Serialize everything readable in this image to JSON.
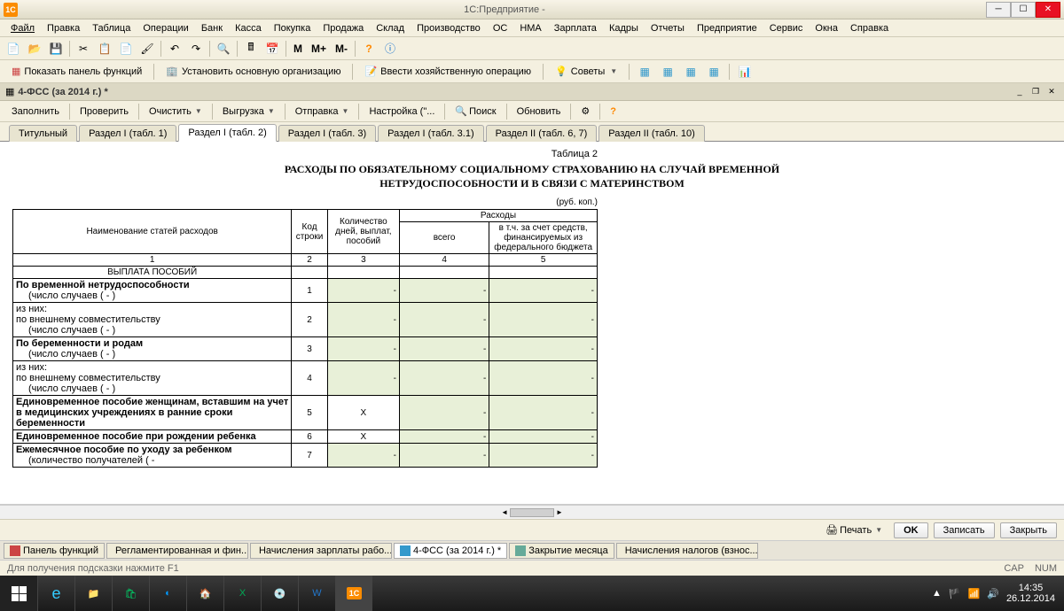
{
  "titlebar": {
    "app": "1С:Предприятие -"
  },
  "menu": [
    "Файл",
    "Правка",
    "Таблица",
    "Операции",
    "Банк",
    "Касса",
    "Покупка",
    "Продажа",
    "Склад",
    "Производство",
    "ОС",
    "НМА",
    "Зарплата",
    "Кадры",
    "Отчеты",
    "Предприятие",
    "Сервис",
    "Окна",
    "Справка"
  ],
  "toolbar2": {
    "show_panel": "Показать панель функций",
    "set_org": "Установить основную организацию",
    "enter_op": "Ввести хозяйственную операцию",
    "tips": "Советы"
  },
  "doc": {
    "title": "4-ФСС (за 2014 г.) *"
  },
  "doc_toolbar": {
    "fill": "Заполнить",
    "check": "Проверить",
    "clear": "Очистить",
    "export": "Выгрузка",
    "send": "Отправка",
    "setup": "Настройка (\"...",
    "search": "Поиск",
    "refresh": "Обновить"
  },
  "tabs": [
    "Титульный",
    "Раздел I (табл. 1)",
    "Раздел I (табл. 2)",
    "Раздел I (табл. 3)",
    "Раздел I (табл. 3.1)",
    "Раздел II (табл. 6, 7)",
    "Раздел II (табл. 10)"
  ],
  "active_tab": 2,
  "report": {
    "table_num": "Таблица 2",
    "title": "РАСХОДЫ ПО ОБЯЗАТЕЛЬНОМУ СОЦИАЛЬНОМУ СТРАХОВАНИЮ НА СЛУЧАЙ ВРЕМЕННОЙ НЕТРУДОСПОСОБНОСТИ И В СВЯЗИ С МАТЕРИНСТВОМ",
    "units": "(руб. коп.)",
    "headers": {
      "name": "Наименование статей расходов",
      "code": "Код строки",
      "days": "Количество дней, выплат, пособий",
      "expenses": "Расходы",
      "total": "всего",
      "federal": "в т.ч. за счет средств, финансируемых из федерального бюджета"
    },
    "col_nums": [
      "1",
      "2",
      "3",
      "4",
      "5"
    ],
    "section": "ВЫПЛАТА ПОСОБИЙ",
    "rows": [
      {
        "name": "По временной нетрудоспособности",
        "sub": "(число случаев (                              - )",
        "code": "1"
      },
      {
        "name": "из них:",
        "name2": "по внешнему совместительству",
        "sub": "(число случаев (                              - )",
        "code": "2"
      },
      {
        "name": "По беременности и родам",
        "sub": "(число случаев (                              - )",
        "code": "3"
      },
      {
        "name": "из них:",
        "name2": "по внешнему совместительству",
        "sub": "(число случаев (                              - )",
        "code": "4"
      },
      {
        "name": "Единовременное пособие женщинам, вставшим на учет в медицинских учреждениях в ранние сроки беременности",
        "code": "5",
        "x": true
      },
      {
        "name": "Единовременное пособие при рождении ребенка",
        "code": "6",
        "x": true
      },
      {
        "name": "Ежемесячное пособие по уходу за ребенком",
        "sub": "(количество получателей (                      -",
        "code": "7"
      }
    ]
  },
  "bottom_bar": {
    "print": "Печать",
    "ok": "OK",
    "save": "Записать",
    "close": "Закрыть"
  },
  "bottom_tabs": [
    "Панель функций",
    "Регламентированная и фин...",
    "Начисления зарплаты рабо...",
    "4-ФСС (за 2014 г.) *",
    "Закрытие месяца",
    "Начисления налогов (взнос..."
  ],
  "statusbar": {
    "hint": "Для получения подсказки нажмите F1",
    "cap": "CAP",
    "num": "NUM"
  },
  "tray": {
    "time": "14:35",
    "date": "26.12.2014"
  }
}
